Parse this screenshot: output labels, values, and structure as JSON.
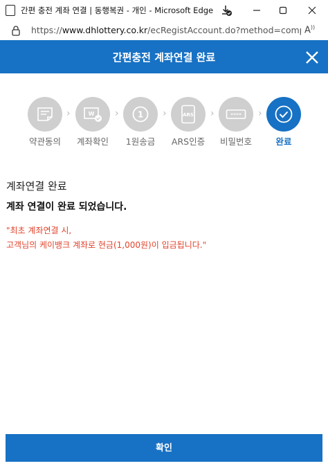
{
  "window": {
    "title": "간편 충전 계좌 연결 | 동행복권 - 개인 - Microsoft Edge",
    "icons": [
      "page-icon",
      "download-icon",
      "minimize-icon",
      "maximize-icon",
      "close-icon"
    ]
  },
  "addressbar": {
    "url_prefix": "https://",
    "url_host": "www.dhlottery.co.kr",
    "url_path": "/ecRegistAccount.do?method=comp...",
    "icons": [
      "lock-icon",
      "read-aloud-icon"
    ]
  },
  "header": {
    "title": "간편충전 계좌연결 완료",
    "icons": [
      "close-icon"
    ]
  },
  "steps": [
    {
      "label": "약관동의",
      "icon": "terms-icon",
      "active": false
    },
    {
      "label": "계좌확인",
      "icon": "account-check-icon",
      "active": false
    },
    {
      "label": "1원송금",
      "icon": "one-won-icon",
      "active": false
    },
    {
      "label": "ARS인증",
      "icon": "ars-phone-icon",
      "active": false
    },
    {
      "label": "비밀번호",
      "icon": "password-icon",
      "active": false
    },
    {
      "label": "완료",
      "icon": "check-icon",
      "active": true
    }
  ],
  "content": {
    "title": "계좌연결 완료",
    "message": "계좌 연결이 완료 되었습니다.",
    "note_line1": "\"최초 계좌연결 시,",
    "note_line2": "고객님의 케이뱅크 계좌로 현금(1,000원)이 입금됩니다.\""
  },
  "colors": {
    "brand_blue": "#1771c4",
    "inactive_step": "#cfcfcf",
    "note_red": "#e0432b"
  },
  "confirm_label": "확인"
}
